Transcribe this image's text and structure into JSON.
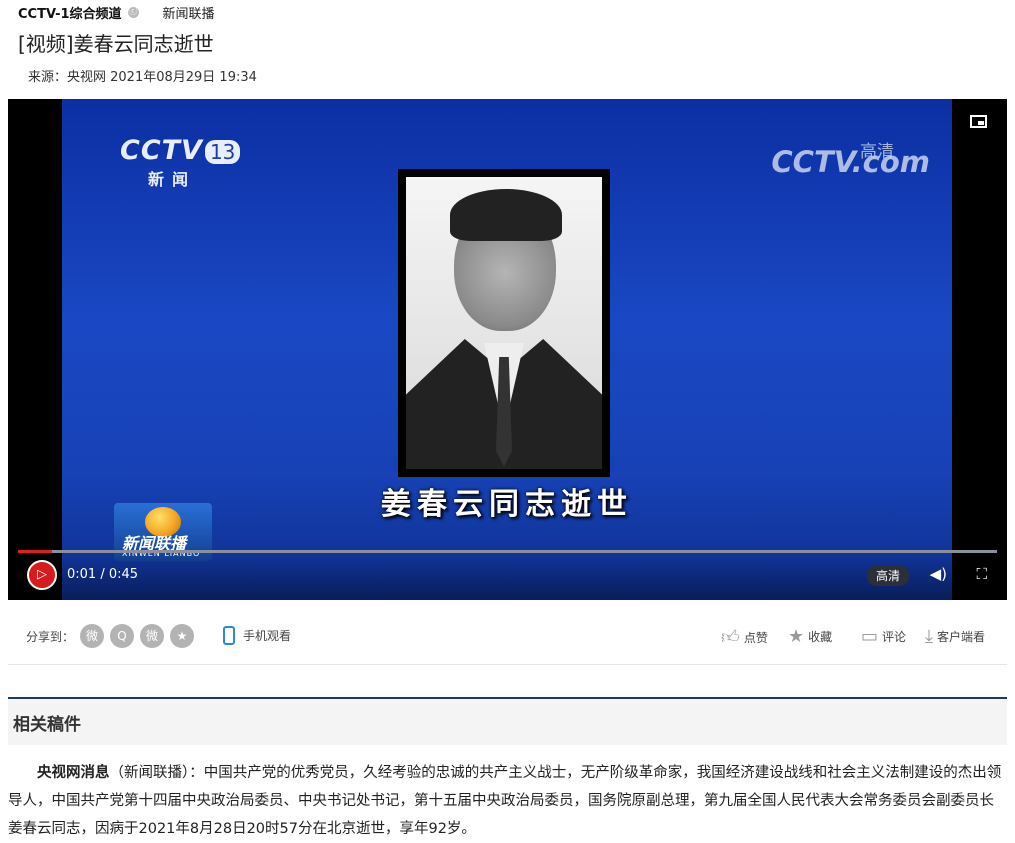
{
  "header": {
    "channel": "CCTV-1综合频道",
    "channel_icon": "ⓒ",
    "program": "新闻联播"
  },
  "article": {
    "title": "[视频]姜春云同志逝世",
    "source": "来源：央视网  2021年08月29日 19:34",
    "lead_bold": "央视网消息",
    "lead_rest": "（新闻联播）：中国共产党的优秀党员，久经考验的忠诚的共产主义战士，无产阶级革命家，我国经济建设战线和社会主义法制建设的杰出领导人，中国共产党第十四届中央政治局委员、中央书记处书记，第十五届中央政治局委员，国务院原副总理，第九届全国人民代表大会常务委员会副委员长姜春云同志，因病于2021年8月28日20时57分在北京逝世，享年92岁。"
  },
  "video": {
    "channel_logo": "CCTV",
    "channel_number": "13",
    "channel_sub": "新闻",
    "watermark": "CCTV.com",
    "watermark_hd": "高清",
    "caption": "姜春云同志逝世",
    "program_logo": "新闻联播",
    "program_logo_sub": "XINWEN LIANBO",
    "current_time": "0:01",
    "duration": "0:45",
    "time_display": "0:01 / 0:45",
    "progress": 0.035,
    "quality": "高清",
    "play_icon": "play-icon",
    "volume_icon": "volume-icon",
    "fullscreen_icon": "fullscreen-icon",
    "pip_icon": "picture-in-picture-icon"
  },
  "share": {
    "label": "分享到：",
    "targets": [
      {
        "icon": "weibo-icon",
        "glyph": "微"
      },
      {
        "icon": "qq-icon",
        "glyph": "Q"
      },
      {
        "icon": "wechat-icon",
        "glyph": "微"
      },
      {
        "icon": "star-icon",
        "glyph": "★"
      }
    ],
    "mobile_label": "手机观看",
    "like_label": "点赞",
    "favorite_label": "收藏",
    "comment_label": "评论",
    "client_label": "客户端看"
  },
  "related": {
    "title": "相关稿件"
  }
}
